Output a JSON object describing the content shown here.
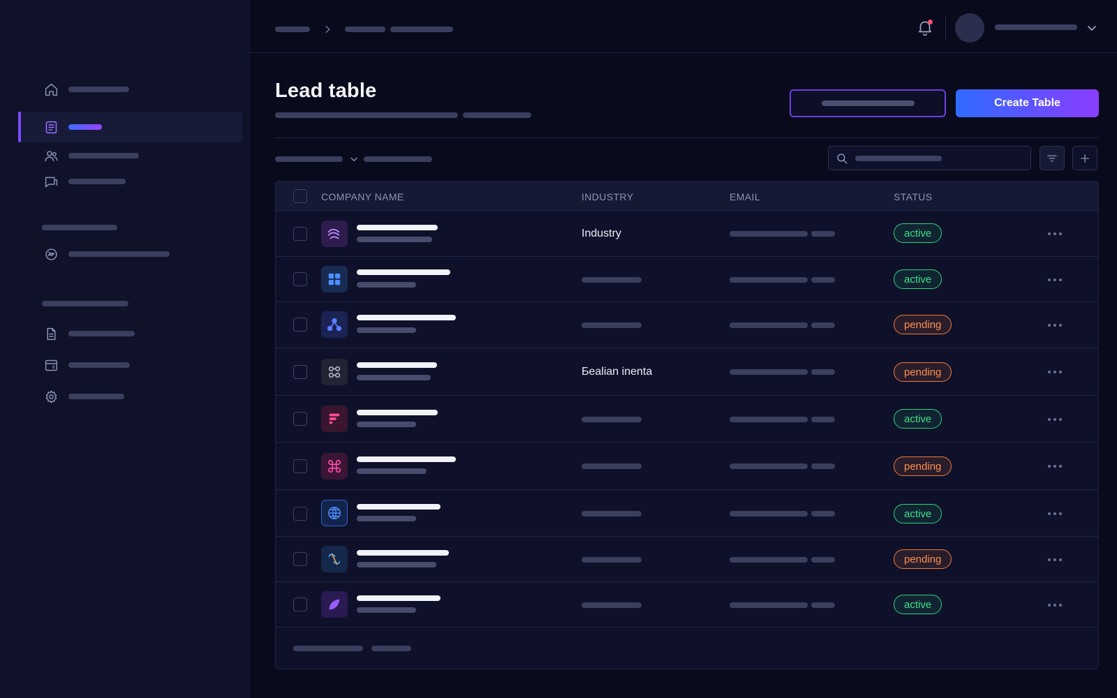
{
  "page": {
    "title": "Lead table",
    "create_button_label": "Create Table"
  },
  "search": {
    "value": ""
  },
  "table": {
    "columns": [
      "COMPANY NAME",
      "INDUSTRY",
      "EMAIL",
      "STATUS"
    ],
    "rows": [
      {
        "logo_icon": "wave-stack-icon",
        "industry": "Industry",
        "status": "active"
      },
      {
        "logo_icon": "grid-four-icon",
        "industry": "",
        "status": "active"
      },
      {
        "logo_icon": "network-node-icon",
        "industry": "",
        "status": "pending"
      },
      {
        "logo_icon": "link-ring-icon",
        "industry": "Ƃealian inenta",
        "status": "pending"
      },
      {
        "logo_icon": "flag-lines-icon",
        "industry": "",
        "status": "active"
      },
      {
        "logo_icon": "command-knot-icon",
        "industry": "",
        "status": "pending"
      },
      {
        "logo_icon": "globe-icon",
        "industry": "",
        "status": "active"
      },
      {
        "logo_icon": "twin-links-icon",
        "industry": "",
        "status": "pending"
      },
      {
        "logo_icon": "leaf-icon",
        "industry": "",
        "status": "active"
      }
    ]
  },
  "colors": {
    "background": "#090b1d",
    "sidebar": "#0f1229",
    "accent_purple": "#7b4bff",
    "accent_blue": "#2f6bff",
    "status_active": "#2fd17c",
    "status_pending": "#f2793a",
    "notification_dot": "#ff4d6d"
  },
  "icons": {
    "sidebar": [
      "home-icon",
      "document-list-icon",
      "users-icon",
      "message-icon",
      "globe-sync-icon",
      "file-icon",
      "calendar-card-icon",
      "gear-icon"
    ],
    "topbar": [
      "chevron-right-icon",
      "bell-icon",
      "chevron-down-icon"
    ],
    "toolbar": [
      "chevron-down-icon",
      "search-icon",
      "filter-icon",
      "plus-icon"
    ]
  }
}
